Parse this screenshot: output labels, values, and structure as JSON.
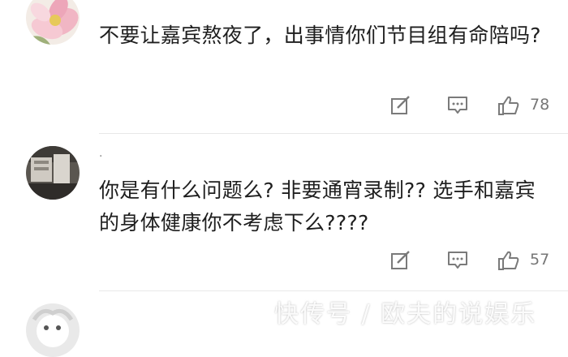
{
  "comments": [
    {
      "text": "不要让嘉宾熬夜了，出事情你们节目组有命陪吗?",
      "likes": "78"
    },
    {
      "username": "·",
      "text": "你是有什么问题么? 非要通宵录制?? 选手和嘉宾的身体健康你不考虑下么????",
      "likes": "57"
    },
    {}
  ],
  "watermark": "快传号 / 欧夫的说娱乐",
  "colors": {
    "text": "#1e1e1e",
    "icon": "#7a7a7a",
    "divider": "#e8e8e8"
  }
}
